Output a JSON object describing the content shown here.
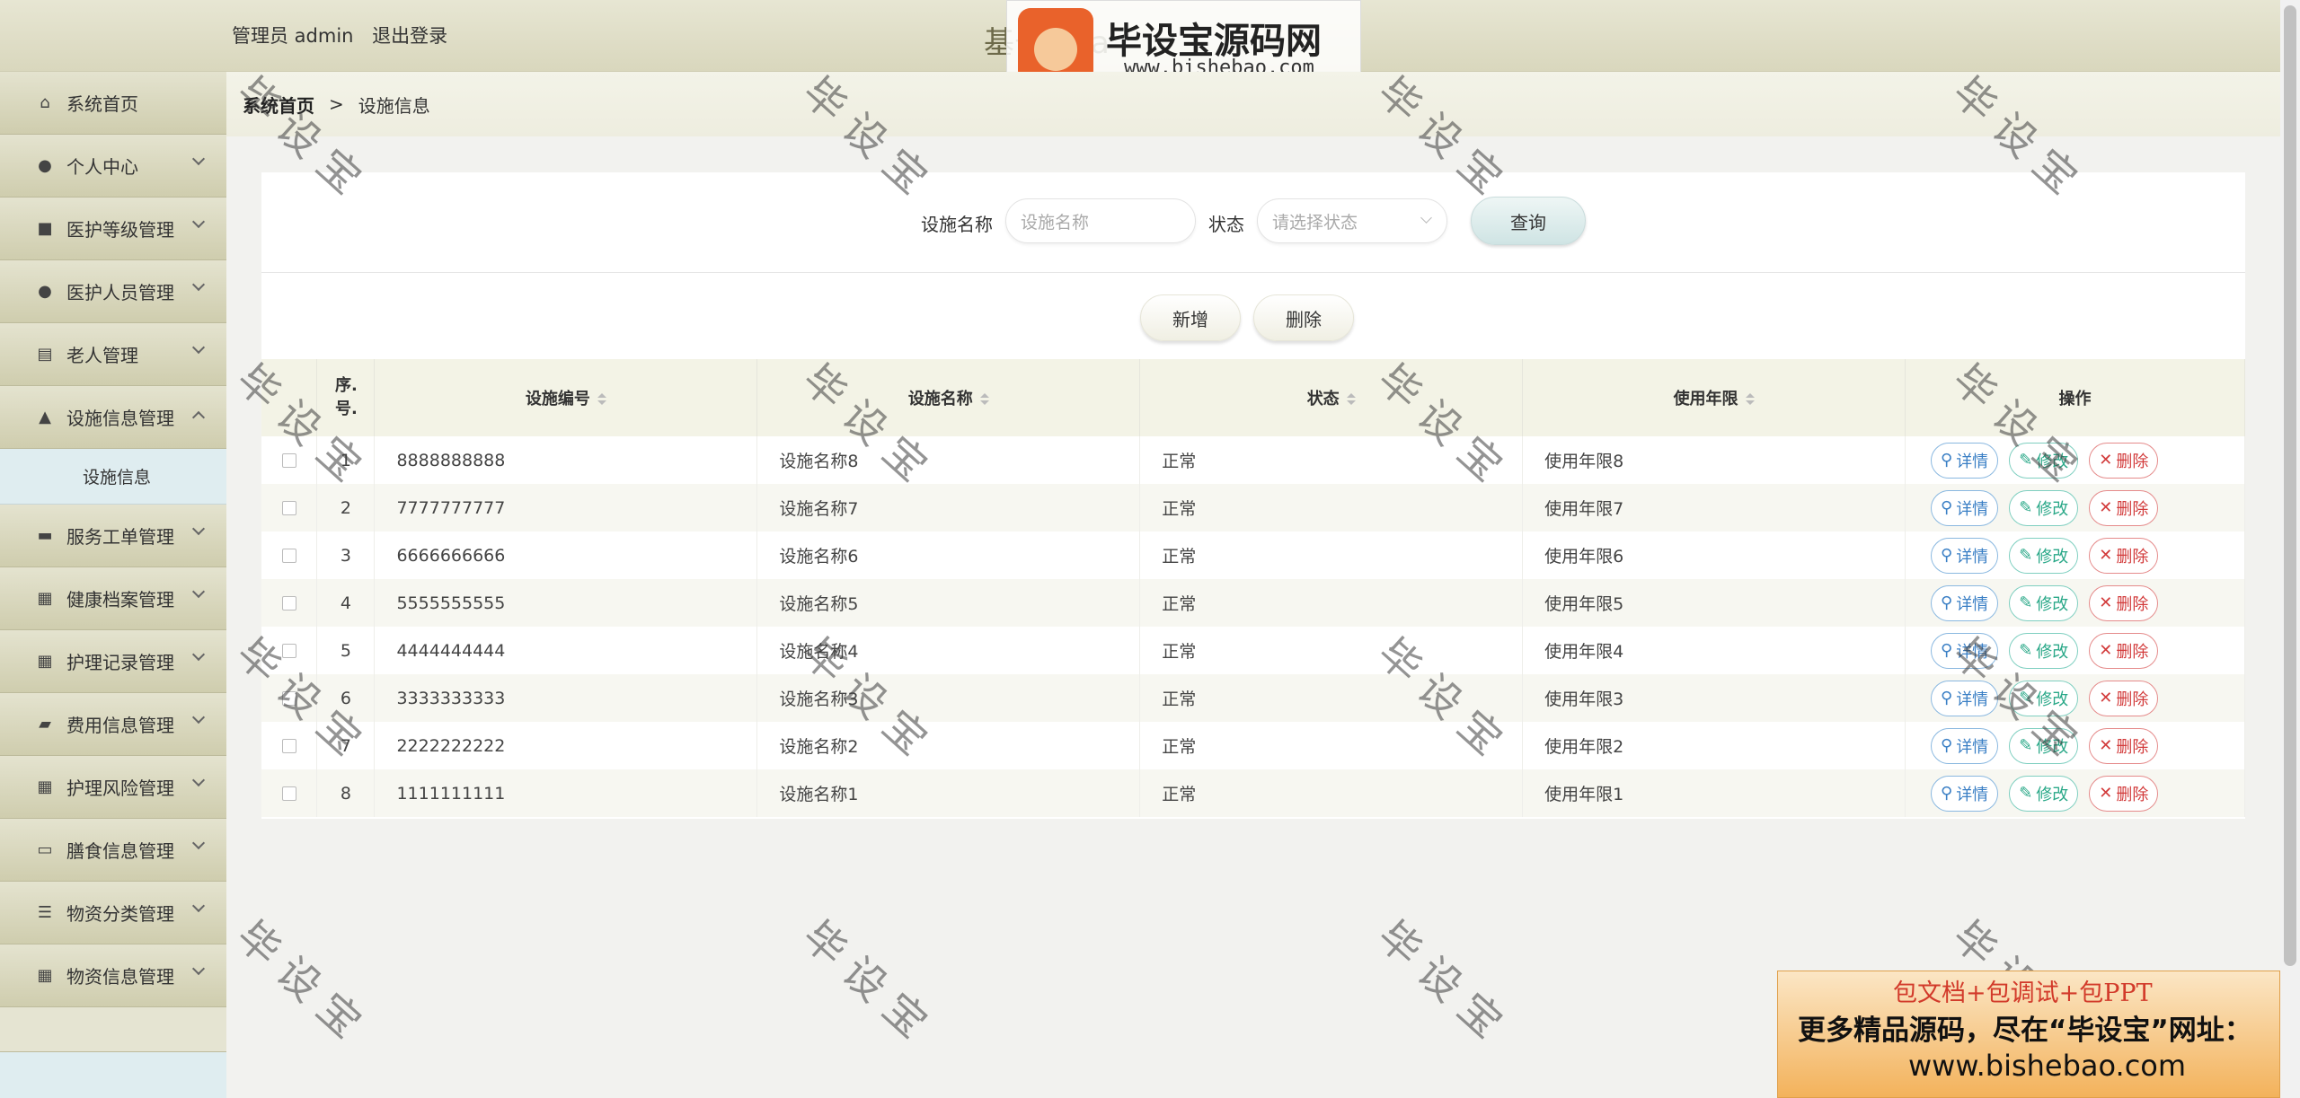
{
  "header": {
    "admin_label": "管理员 admin",
    "logout_label": "退出登录",
    "system_title": "基于Java",
    "logo_cn": "毕设宝源码网",
    "logo_url": "www.bishebao.com"
  },
  "sidebar": {
    "items": [
      {
        "label": "系统首页",
        "icon": "home-icon",
        "glyph": "⌂"
      },
      {
        "label": "个人中心",
        "icon": "user-icon",
        "glyph": "●"
      },
      {
        "label": "医护等级管理",
        "icon": "briefcase-icon",
        "glyph": "■"
      },
      {
        "label": "医护人员管理",
        "icon": "user-icon",
        "glyph": "●"
      },
      {
        "label": "老人管理",
        "icon": "clipboard-icon",
        "glyph": "▤"
      },
      {
        "label": "设施信息管理",
        "icon": "stamp-icon",
        "glyph": "▲"
      },
      {
        "label": "服务工单管理",
        "icon": "printer-icon",
        "glyph": "▬"
      },
      {
        "label": "健康档案管理",
        "icon": "grid-icon",
        "glyph": "▦"
      },
      {
        "label": "护理记录管理",
        "icon": "grid-icon",
        "glyph": "▦"
      },
      {
        "label": "费用信息管理",
        "icon": "ticket-icon",
        "glyph": "▰"
      },
      {
        "label": "护理风险管理",
        "icon": "grid-icon",
        "glyph": "▦"
      },
      {
        "label": "膳食信息管理",
        "icon": "monitor-icon",
        "glyph": "▭"
      },
      {
        "label": "物资分类管理",
        "icon": "list-icon",
        "glyph": "☰"
      },
      {
        "label": "物资信息管理",
        "icon": "grid-icon",
        "glyph": "▦"
      }
    ],
    "submenu_label": "设施信息"
  },
  "breadcrumb": {
    "home": "系统首页",
    "separator": ">",
    "current": "设施信息"
  },
  "search": {
    "name_label": "设施名称",
    "name_placeholder": "设施名称",
    "status_label": "状态",
    "status_placeholder": "请选择状态",
    "query_label": "查询"
  },
  "actions": {
    "add_label": "新增",
    "delete_label": "删除"
  },
  "table": {
    "headers": {
      "index": "序.号.",
      "code": "设施编号",
      "name": "设施名称",
      "status": "状态",
      "years": "使用年限",
      "ops": "操作"
    },
    "rows": [
      {
        "idx": "1",
        "code": "8888888888",
        "name": "设施名称8",
        "status": "正常",
        "years": "使用年限8"
      },
      {
        "idx": "2",
        "code": "7777777777",
        "name": "设施名称7",
        "status": "正常",
        "years": "使用年限7"
      },
      {
        "idx": "3",
        "code": "6666666666",
        "name": "设施名称6",
        "status": "正常",
        "years": "使用年限6"
      },
      {
        "idx": "4",
        "code": "5555555555",
        "name": "设施名称5",
        "status": "正常",
        "years": "使用年限5"
      },
      {
        "idx": "5",
        "code": "4444444444",
        "name": "设施名称4",
        "status": "正常",
        "years": "使用年限4"
      },
      {
        "idx": "6",
        "code": "3333333333",
        "name": "设施名称3",
        "status": "正常",
        "years": "使用年限3"
      },
      {
        "idx": "7",
        "code": "2222222222",
        "name": "设施名称2",
        "status": "正常",
        "years": "使用年限2"
      },
      {
        "idx": "8",
        "code": "1111111111",
        "name": "设施名称1",
        "status": "正常",
        "years": "使用年限1"
      }
    ],
    "op_labels": {
      "detail": "详情",
      "edit": "修改",
      "delete": "删除"
    }
  },
  "watermark_text": "毕设宝",
  "ad": {
    "line1": "包文档+包调试+包PPT",
    "line2": "更多精品源码，尽在“毕设宝”网址：",
    "line3": "www.bishebao.com"
  }
}
